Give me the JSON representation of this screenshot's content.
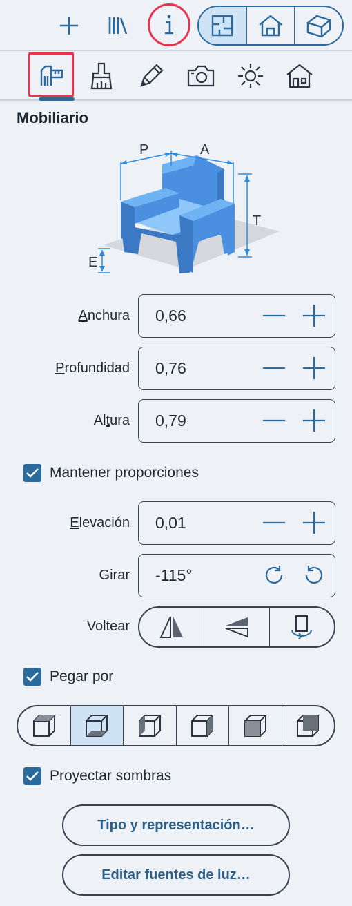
{
  "toolbar": {
    "add_icon": "plus-icon",
    "library_icon": "library-icon",
    "info_icon": "info-icon",
    "views": [
      {
        "icon": "floorplan-view-icon",
        "active": true
      },
      {
        "icon": "house-front-view-icon",
        "active": false
      },
      {
        "icon": "house-3d-view-icon",
        "active": false
      }
    ]
  },
  "tabs": [
    {
      "icon": "dimensions-tab-icon",
      "active": true
    },
    {
      "icon": "brush-tab-icon",
      "active": false
    },
    {
      "icon": "pencil-tab-icon",
      "active": false
    },
    {
      "icon": "camera-tab-icon",
      "active": false
    },
    {
      "icon": "sun-tab-icon",
      "active": false
    },
    {
      "icon": "building-tab-icon",
      "active": false
    }
  ],
  "section": {
    "title": "Mobiliario"
  },
  "illustration": {
    "label_p": "P",
    "label_a": "A",
    "label_t": "T",
    "label_e": "E",
    "chair_color": "#5aa6f0"
  },
  "fields": {
    "width": {
      "label_first": "A",
      "label_rest": "nchura",
      "value": "0,66"
    },
    "depth": {
      "label_first": "P",
      "label_rest": "rofundidad",
      "value": "0,76"
    },
    "height": {
      "label_pre": "Al",
      "label_under": "t",
      "label_post": "ura",
      "value": "0,79"
    },
    "elevation": {
      "label_first": "E",
      "label_rest": "levación",
      "value": "0,01"
    },
    "rotate": {
      "label": "Girar",
      "value": "-115°"
    }
  },
  "keep_proportions": {
    "label": "Mantener proporciones",
    "checked": true
  },
  "flip": {
    "label": "Voltear",
    "buttons": [
      "flip-horizontal-icon",
      "flip-vertical-icon",
      "flip-around-icon"
    ]
  },
  "stick_to": {
    "label": "Pegar por",
    "checked": true,
    "selected_index": 1
  },
  "cast_shadows": {
    "label": "Proyectar sombras",
    "checked": true
  },
  "buttons": {
    "type_repr": "Tipo y representación…",
    "edit_lights": "Editar fuentes de luz…"
  },
  "colors": {
    "accent": "#2b6a9c",
    "highlight": "#e8334f",
    "active_bg": "#cfe3f7",
    "background": "#eef1f6"
  }
}
